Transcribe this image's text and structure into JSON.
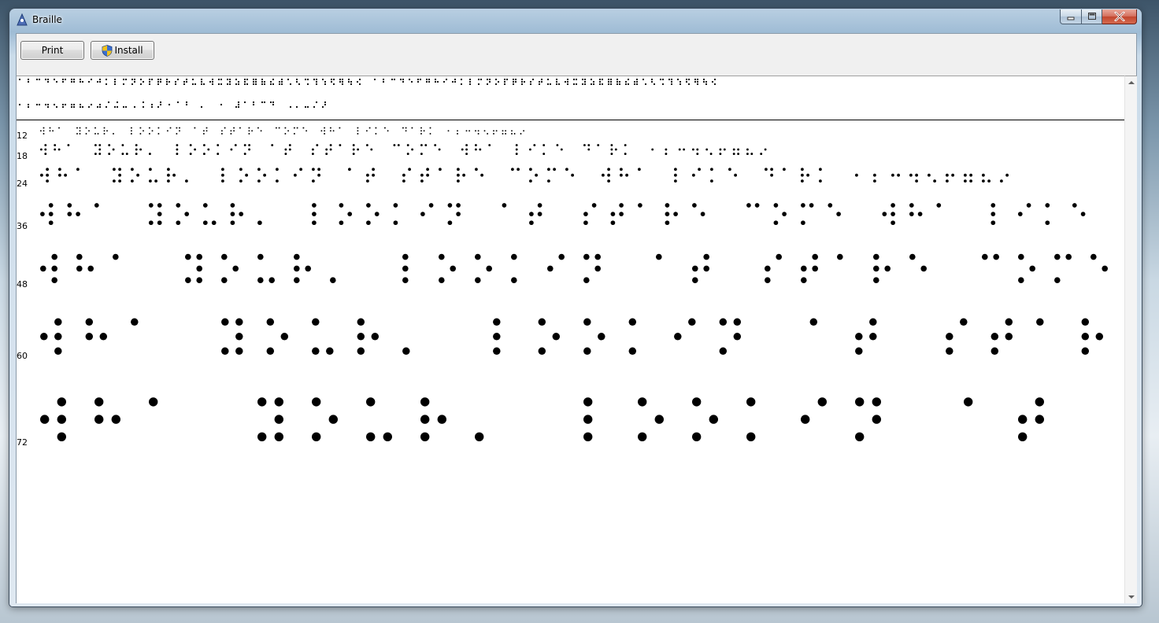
{
  "window": {
    "title": "Braille"
  },
  "toolbar": {
    "print_label": "Print",
    "install_label": "Install"
  },
  "icons": {
    "app": "braille-app-icon",
    "install": "uac-shield-icon",
    "minimize": "minimize-icon",
    "maximize": "maximize-icon",
    "close": "close-icon"
  },
  "braille": {
    "charset_line_1": "⠁⠃⠉⠙⠑⠋⠛⠓⠊⠚⠅⠇⠍⠝⠕⠏⠟⠗⠎⠞⠥⠧⠺⠭⠽⠵⠯⠿⠷⠮⠾⠡⠣⠩⠹⠱⠫⠻⠳⠪ ⠁⠃⠉⠙⠑⠋⠛⠓⠊⠚⠅⠇⠍⠝⠕⠏⠟⠗⠎⠞⠥⠧⠺⠭⠽⠵⠯⠿⠷⠮⠾⠡⠣⠩⠹⠱⠫⠻⠳⠪",
    "charset_line_2": "⠂⠆⠒⠲⠢⠖⠶⠦⠔⠴⠌⠬⠤⠠⠨⠰⠜⠐⠈⠘ ⠄ ⠐ ⠼⠁⠃⠉⠙ ⠠⠄⠤⠌⠜",
    "sample_text": "⠺⠓⠁ ⠽⠕⠥⠗⠄ ⠇⠕⠕⠅⠊⠝ ⠁⠞ ⠎⠞⠁⠗⠑ ⠉⠕⠍⠑ ⠺⠓⠁ ⠇⠊⠅⠑ ⠙⠁⠗⠅ ⠂⠆⠒⠲⠢⠖⠶⠦⠔",
    "sizes": [
      {
        "label": "12",
        "pt": 12
      },
      {
        "label": "18",
        "pt": 18
      },
      {
        "label": "24",
        "pt": 24
      },
      {
        "label": "36",
        "pt": 36
      },
      {
        "label": "48",
        "pt": 48
      },
      {
        "label": "60",
        "pt": 60
      },
      {
        "label": "72",
        "pt": 72
      }
    ]
  }
}
